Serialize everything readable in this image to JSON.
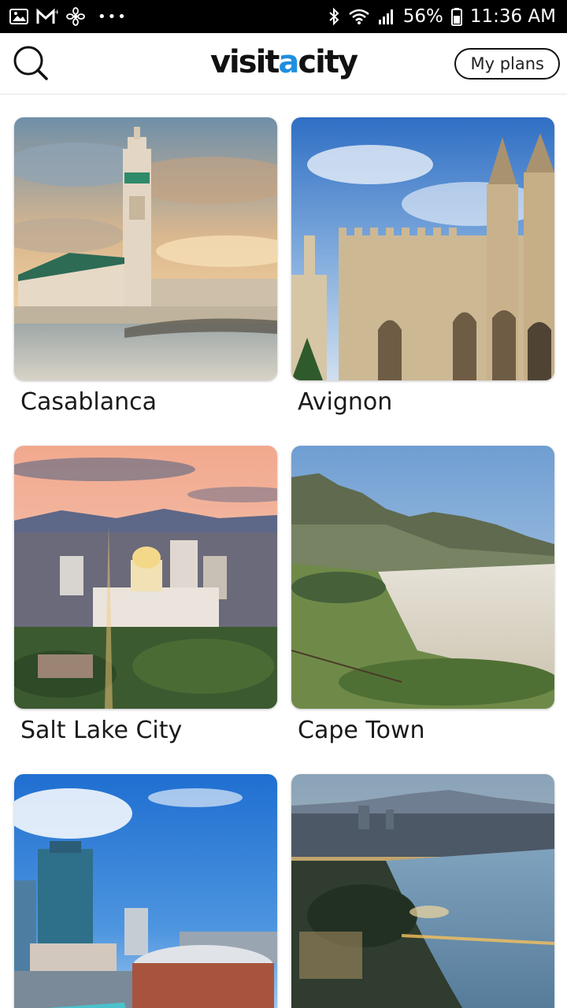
{
  "status_bar": {
    "icons_left": [
      "gallery-icon",
      "gmail-icon",
      "fan-icon",
      "more-dots-icon"
    ],
    "icons_right": [
      "bluetooth-icon",
      "wifi-icon",
      "signal-icon",
      "battery-icon"
    ],
    "battery": "56%",
    "time": "11:36 AM"
  },
  "header": {
    "logo_part1": "visit",
    "logo_accent": "a",
    "logo_part2": "city",
    "accent_color": "#1e90e0",
    "my_plans_label": "My plans",
    "search_icon": "search-icon"
  },
  "cities": [
    {
      "name": "Casablanca",
      "image": "casablanca-photo"
    },
    {
      "name": "Avignon",
      "image": "avignon-photo"
    },
    {
      "name": "Salt Lake City",
      "image": "salt-lake-city-photo"
    },
    {
      "name": "Cape Town",
      "image": "cape-town-photo"
    },
    {
      "name": "",
      "image": "city-skyline-photo"
    },
    {
      "name": "",
      "image": "lakeside-city-night-photo"
    }
  ]
}
